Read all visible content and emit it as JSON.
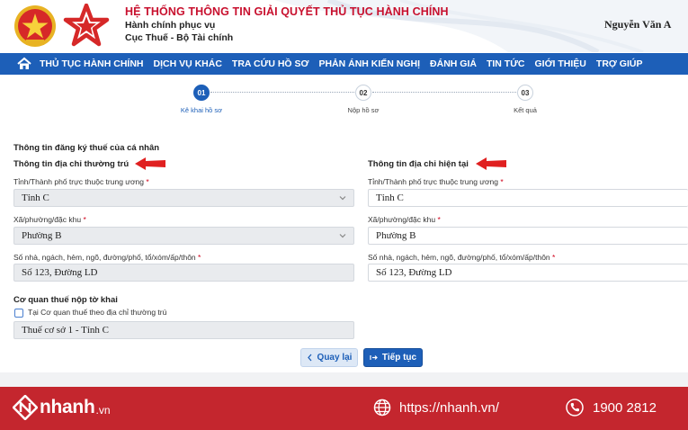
{
  "header": {
    "system_title": "HỆ THỐNG THÔNG TIN GIẢI QUYẾT THỦ TỤC HÀNH CHÍNH",
    "subtitle_1": "Hành chính phục vụ",
    "subtitle_2": "Cục Thuế - Bộ Tài chính",
    "user_name": "Nguyễn Văn A"
  },
  "nav": {
    "items": [
      "THỦ TỤC HÀNH CHÍNH",
      "DỊCH VỤ KHÁC",
      "TRA CỨU HỒ SƠ",
      "PHẢN ÁNH KIẾN NGHỊ",
      "ĐÁNH GIÁ",
      "TIN TỨC",
      "GIỚI THIỆU",
      "TRỢ GIÚP"
    ]
  },
  "steps": [
    {
      "number": "01",
      "label": "Kê khai hồ sơ",
      "active": true
    },
    {
      "number": "02",
      "label": "Nộp hồ sơ",
      "active": false
    },
    {
      "number": "03",
      "label": "Kết quả",
      "active": false
    }
  ],
  "form": {
    "title": "Thông tin đăng ký thuế của cá nhân",
    "permanent": {
      "heading": "Thông tin địa chỉ thường trú",
      "province_label": "Tỉnh/Thành phố trực thuộc trung ương",
      "province_value": "Tỉnh C",
      "ward_label": "Xã/phường/đặc khu",
      "ward_value": "Phường B",
      "street_label": "Số nhà, ngách, hẻm, ngõ, đường/phố, tổ/xóm/ấp/thôn",
      "street_value": "Số 123, Đường LD"
    },
    "current": {
      "heading": "Thông tin địa chỉ hiện tại",
      "province_label": "Tỉnh/Thành phố trực thuộc trung ương",
      "province_value": "Tỉnh C",
      "ward_label": "Xã/phường/đặc khu",
      "ward_value": "Phường B",
      "street_label": "Số nhà, ngách, hẻm, ngõ, đường/phố, tổ/xóm/ấp/thôn",
      "street_value": "Số 123, Đường LD"
    },
    "tax_office": {
      "heading": "Cơ quan thuế nộp tờ khai",
      "checkbox_label": "Tại Cơ quan thuế theo địa chỉ thường trú",
      "checkbox_checked": false,
      "value": "Thuế cơ sở 1 - Tỉnh C"
    },
    "required_mark": "*"
  },
  "buttons": {
    "back_label": "Quay lại",
    "back_icon": "chevron-left-icon",
    "next_label": "Tiếp tục",
    "next_icon": "arrow-right-icon"
  },
  "footer": {
    "brand_name": "nhanh",
    "brand_tld": ".vn",
    "website": "https://nhanh.vn/",
    "phone": "1900 2812"
  },
  "colors": {
    "primary_blue": "#1d5fb8",
    "title_red": "#c8102e",
    "footer_red": "#c4262e",
    "indicator_red": "#e02020"
  }
}
